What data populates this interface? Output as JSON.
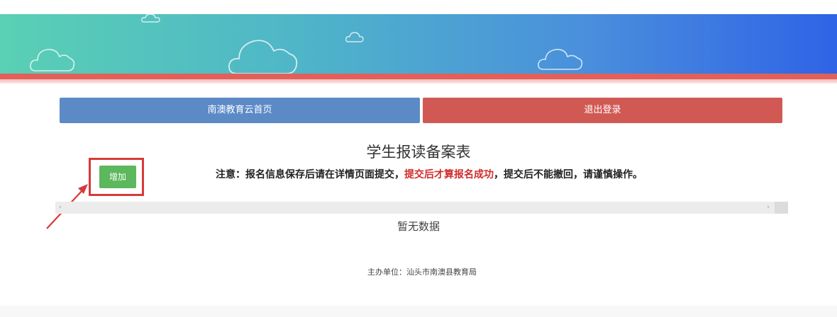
{
  "nav": {
    "home_label": "南澳教育云首页",
    "logout_label": "退出登录",
    "home_color": "#5b8ac7",
    "logout_color": "#d05a53"
  },
  "form": {
    "title": "学生报读备案表",
    "add_label": "增加",
    "notice_prefix": "注意：报名信息保存后请在详情页面提交，",
    "notice_highlight": "提交后才算报名成功",
    "notice_suffix": "，提交后不能撤回，请谨慎操作。"
  },
  "table": {
    "empty_text": "暂无数据",
    "scroll_left_icon": "‹",
    "scroll_right_icon": "›"
  },
  "footer": {
    "text": "主办单位：汕头市南澳县教育局"
  },
  "colors": {
    "accent_red": "#d12b2b",
    "add_green": "#5cb85c",
    "highlight_frame": "#d63a3a"
  }
}
